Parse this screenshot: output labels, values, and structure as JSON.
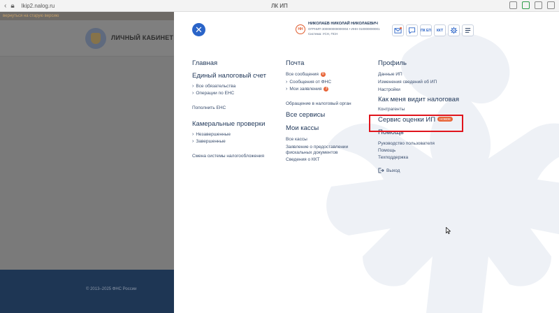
{
  "browser": {
    "url": "lkip2.nalog.ru",
    "tab_title": "ЛК ИП"
  },
  "background": {
    "notice": "вернуться на старую версию",
    "title": "ЛИЧНЫЙ КАБИНЕТ ИП",
    "copyright": "© 2013–2025 ФНС России"
  },
  "user": {
    "initials": "НН",
    "name": "НИКОЛАЕВ НИКОЛАЙ НИКОЛАЕВИЧ",
    "ids": "ОГРНИП 300000000000004  •  ИНН 010000000001",
    "tax_system": "Система: УСН, ПСН"
  },
  "toolbar": {
    "mail_icon": "mail-icon",
    "chat_icon": "chat-icon",
    "pkep_label": "ПК ЕП",
    "kkt_label": "ККТ",
    "settings_icon": "gear-icon",
    "menu_icon": "menu-icon"
  },
  "menu": {
    "col1": {
      "main": "Главная",
      "ens": "Единый налоговый счет",
      "ens_items": [
        "Все обязательства",
        "Операции по ЕНС"
      ],
      "ens_topup": "Пополнить ЕНС",
      "audits": "Камеральные проверки",
      "audits_items": [
        "Незавершенные",
        "Завершенные"
      ],
      "change_tax": "Смена системы налогообложения"
    },
    "col2": {
      "mail": "Почта",
      "mail_all": "Все сообщения",
      "mail_all_count": "8",
      "mail_items": [
        "Сообщения от ФНС",
        "Мои заявления"
      ],
      "mail_items_count": "3",
      "appeal": "Обращение в налоговый орган",
      "services": "Все сервисы",
      "kassy": "Мои кассы",
      "kassy_all": "Все кассы",
      "kassy_app_1": "Заявление о предоставлении",
      "kassy_app_2": "фискальных документов",
      "kkt_info": "Сведения о ККТ"
    },
    "col3": {
      "profile": "Профиль",
      "profile_items": [
        "Данные ИП",
        "Изменения сведений об ИП",
        "Настройки"
      ],
      "tax_view": "Как меня видит налоговая",
      "counterparties": "Контрагенты",
      "service_rating": "Сервис оценки ИП",
      "new_badge": "НОВОЕ",
      "help": "Помощь",
      "help_items": [
        "Руководство пользователя",
        "Помощь",
        "Техподдержка"
      ],
      "logout": "Выход"
    }
  }
}
